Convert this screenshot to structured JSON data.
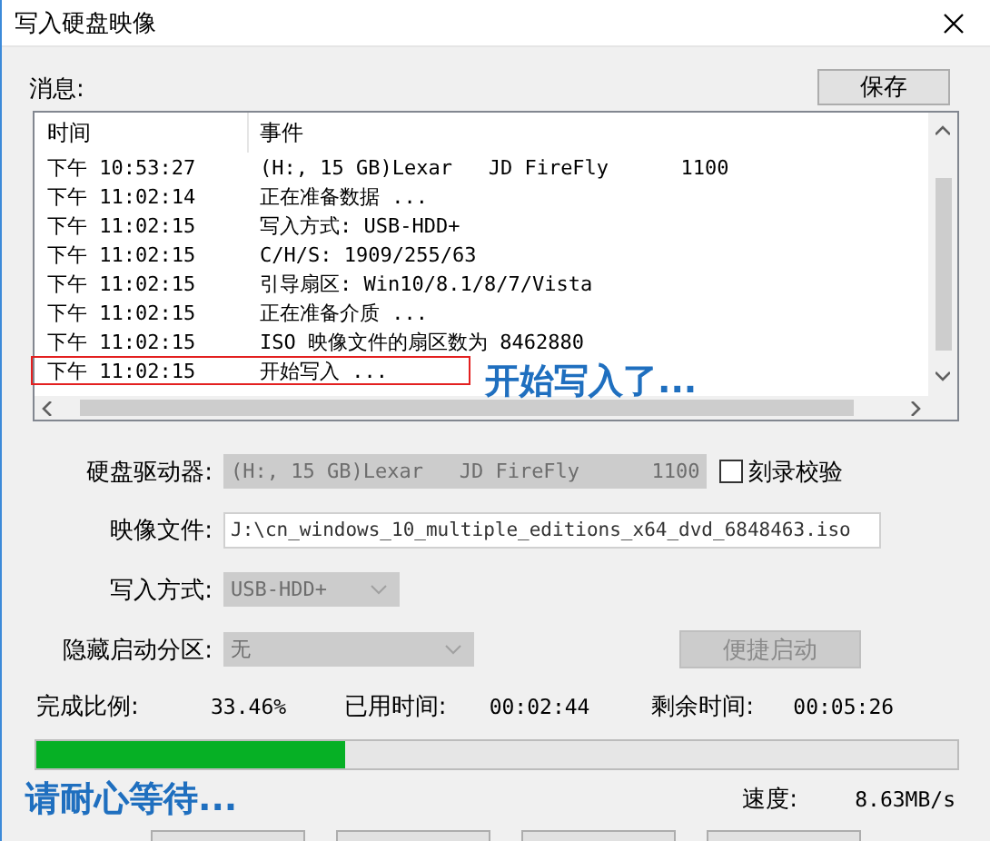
{
  "window": {
    "title": "写入硬盘映像"
  },
  "messages": {
    "label": "消息:",
    "save_button": "保存",
    "columns": [
      "时间",
      "事件"
    ],
    "rows": [
      {
        "time": "下午 10:53:27",
        "event": "(H:, 15 GB)Lexar   JD FireFly      1100",
        "highlighted": false
      },
      {
        "time": "下午 11:02:14",
        "event": "正在准备数据 ...",
        "highlighted": false
      },
      {
        "time": "下午 11:02:15",
        "event": "写入方式: USB-HDD+",
        "highlighted": false
      },
      {
        "time": "下午 11:02:15",
        "event": "C/H/S: 1909/255/63",
        "highlighted": false
      },
      {
        "time": "下午 11:02:15",
        "event": "引导扇区: Win10/8.1/8/7/Vista",
        "highlighted": false
      },
      {
        "time": "下午 11:02:15",
        "event": "正在准备介质 ...",
        "highlighted": false
      },
      {
        "time": "下午 11:02:15",
        "event": "ISO 映像文件的扇区数为 8462880",
        "highlighted": false
      },
      {
        "time": "下午 11:02:15",
        "event": "开始写入 ...",
        "highlighted": true
      }
    ],
    "annotation": "开始写入了..."
  },
  "form": {
    "drive": {
      "label": "硬盘驱动器:",
      "value": "(H:, 15 GB)Lexar   JD FireFly      1100",
      "disabled": true
    },
    "verify": {
      "label": "刻录校验",
      "checked": false
    },
    "image_file": {
      "label": "映像文件:",
      "value": "J:\\cn_windows_10_multiple_editions_x64_dvd_6848463.iso"
    },
    "write_mode": {
      "label": "写入方式:",
      "value": "USB-HDD+",
      "disabled": true
    },
    "hidden_partition": {
      "label": "隐藏启动分区:",
      "value": "无",
      "disabled": true
    },
    "quick_boot_button": {
      "label": "便捷启动",
      "disabled": true
    }
  },
  "progress": {
    "stats": [
      {
        "label": "完成比例:",
        "value": "33.46%"
      },
      {
        "label": "已用时间:",
        "value": "00:02:44"
      },
      {
        "label": "剩余时间:",
        "value": "00:05:26"
      }
    ],
    "level": 0.3346,
    "annotation": "请耐心等待...",
    "speed_label": "速度:",
    "speed": "8.63MB/s"
  }
}
